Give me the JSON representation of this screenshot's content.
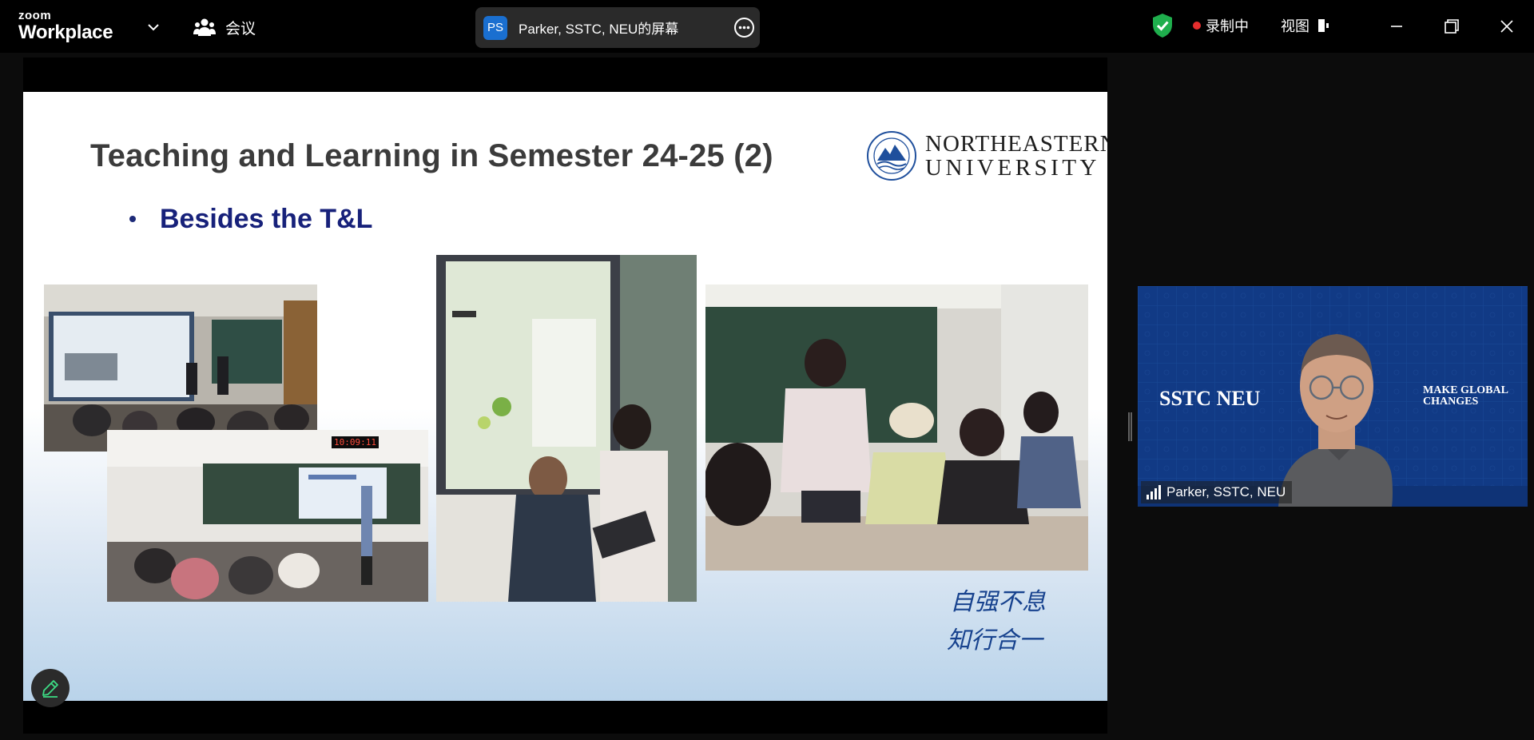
{
  "topbar": {
    "brand_small": "zoom",
    "brand_big": "Workplace",
    "meeting_label": "会议",
    "share_avatar": "PS",
    "share_title": "Parker, SSTC, NEU的屏幕",
    "recording_label": "录制中",
    "view_label": "视图"
  },
  "slide": {
    "title": "Teaching and Learning in Semester 24-25 (2)",
    "logo_line1": "NORTHEASTERN",
    "logo_line2": "UNIVERSITY",
    "bullet": "Besides the T&L",
    "photo1_badge": "10:09:11",
    "motto_line1": "自强不息",
    "motto_line2": "知行合一"
  },
  "video": {
    "participant_name": "Parker, SSTC, NEU",
    "backdrop_left": "SSTC NEU",
    "backdrop_right_1": "MAKE GLOBAL",
    "backdrop_right_2": "CHANGES"
  },
  "colors": {
    "topbar_bg": "#000000",
    "share_pill": "#2a2a2a",
    "avatar_blue": "#1a6fd0",
    "recording_red": "#e62e2e",
    "shield_green": "#1fae4d",
    "slide_title": "#3b3b3b",
    "bullet_navy": "#17217a",
    "video_bg": "#113a85"
  },
  "icons": [
    "chevron-down-icon",
    "participants-icon",
    "more-icon",
    "shield-check-icon",
    "recording-dot-icon",
    "view-layout-icon",
    "minimize-icon",
    "restore-icon",
    "close-icon",
    "pen-icon",
    "signal-icon"
  ]
}
